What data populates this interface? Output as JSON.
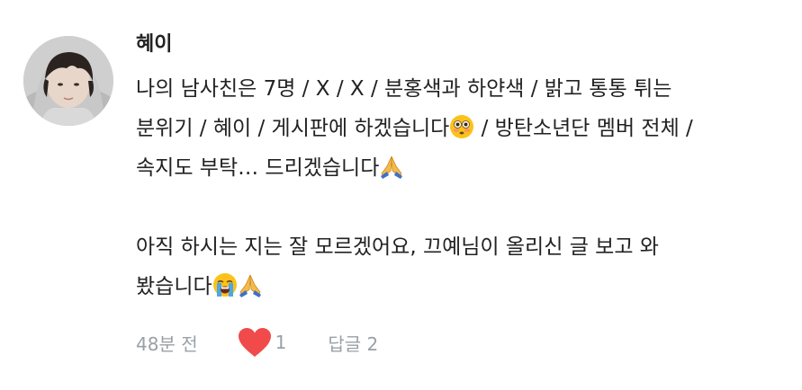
{
  "comment": {
    "author": "혜이",
    "lines": [
      "나의 남사친은 7명 / X / X / 분홍색과 하얀색 / 밝고 통통 튀는",
      "분위기 / 혜이 / 게시판에 하겠습니다",
      " / 방탄소년단 멤버 전체 /",
      "속지도 부탁… 드리겠습니다",
      "아직 하시는 지는 잘 모르겠어요, 끄예님이 올리신 글 보고 와",
      "봤습니다"
    ],
    "emojis": {
      "flushed": "flushed-face-emoji",
      "pray": "folded-hands-emoji",
      "crying": "loudly-crying-face-emoji"
    },
    "timestamp": "48분 전",
    "like_count": "1",
    "reply_label": "답글 2"
  },
  "colors": {
    "text": "#222222",
    "meta": "#9aa0a6",
    "heart": "#f04a4a"
  }
}
